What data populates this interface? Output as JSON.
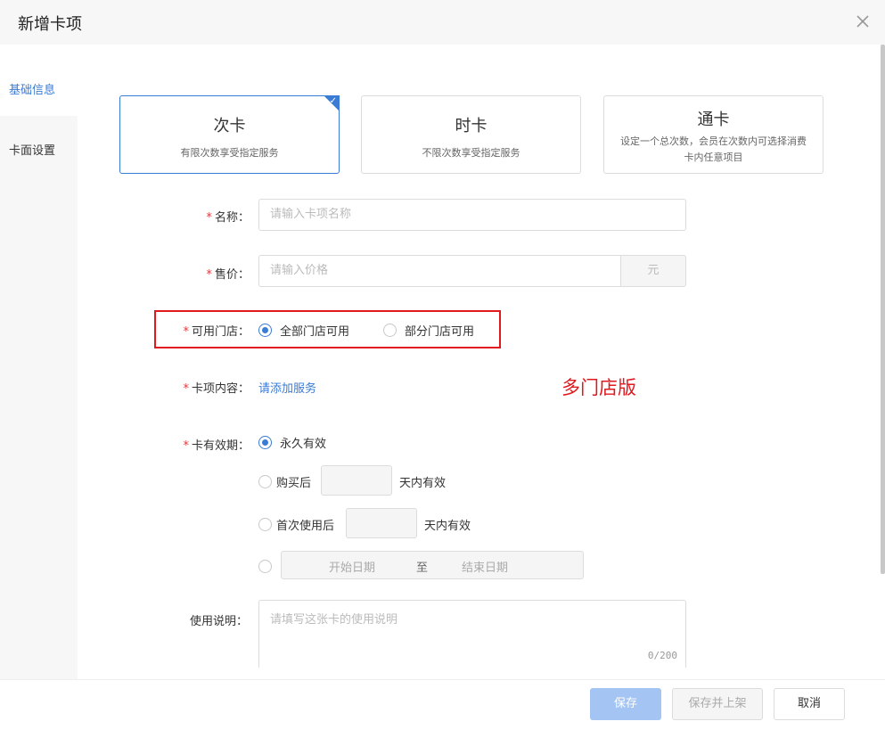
{
  "dialog": {
    "title": "新增卡项"
  },
  "sidebar": {
    "items": [
      {
        "label": "基础信息"
      },
      {
        "label": "卡面设置"
      }
    ]
  },
  "card_types": [
    {
      "name": "次卡",
      "desc": "有限次数享受指定服务",
      "selected": true
    },
    {
      "name": "时卡",
      "desc": "不限次数享受指定服务",
      "selected": false
    },
    {
      "name": "通卡",
      "desc": "设定一个总次数，会员在次数内可选择消费卡内任意项目",
      "selected": false
    }
  ],
  "form": {
    "name": {
      "label": "名称：",
      "placeholder": "请输入卡项名称"
    },
    "price": {
      "label": "售价：",
      "placeholder": "请输入价格",
      "unit": "元"
    },
    "stores": {
      "label": "可用门店：",
      "options": [
        "全部门店可用",
        "部分门店可用"
      ],
      "selected": "全部门店可用"
    },
    "content": {
      "label": "卡项内容：",
      "link": "请添加服务"
    },
    "validity": {
      "label": "卡有效期：",
      "forever": "永久有效",
      "after_purchase": {
        "prefix": "购买后",
        "suffix": "天内有效"
      },
      "after_first_use": {
        "prefix": "首次使用后",
        "suffix": "天内有效"
      },
      "range": {
        "start": "开始日期",
        "sep": "至",
        "end": "结束日期"
      },
      "selected": "永久有效"
    },
    "instructions": {
      "label": "使用说明：",
      "placeholder": "请填写这张卡的使用说明",
      "counter": "0/200"
    }
  },
  "annotation": "多门店版",
  "footer": {
    "save": "保存",
    "save_and_list": "保存并上架",
    "cancel": "取消"
  },
  "colors": {
    "accent": "#3a7bd5",
    "required": "#e0393e",
    "annotation": "#e0191f"
  }
}
